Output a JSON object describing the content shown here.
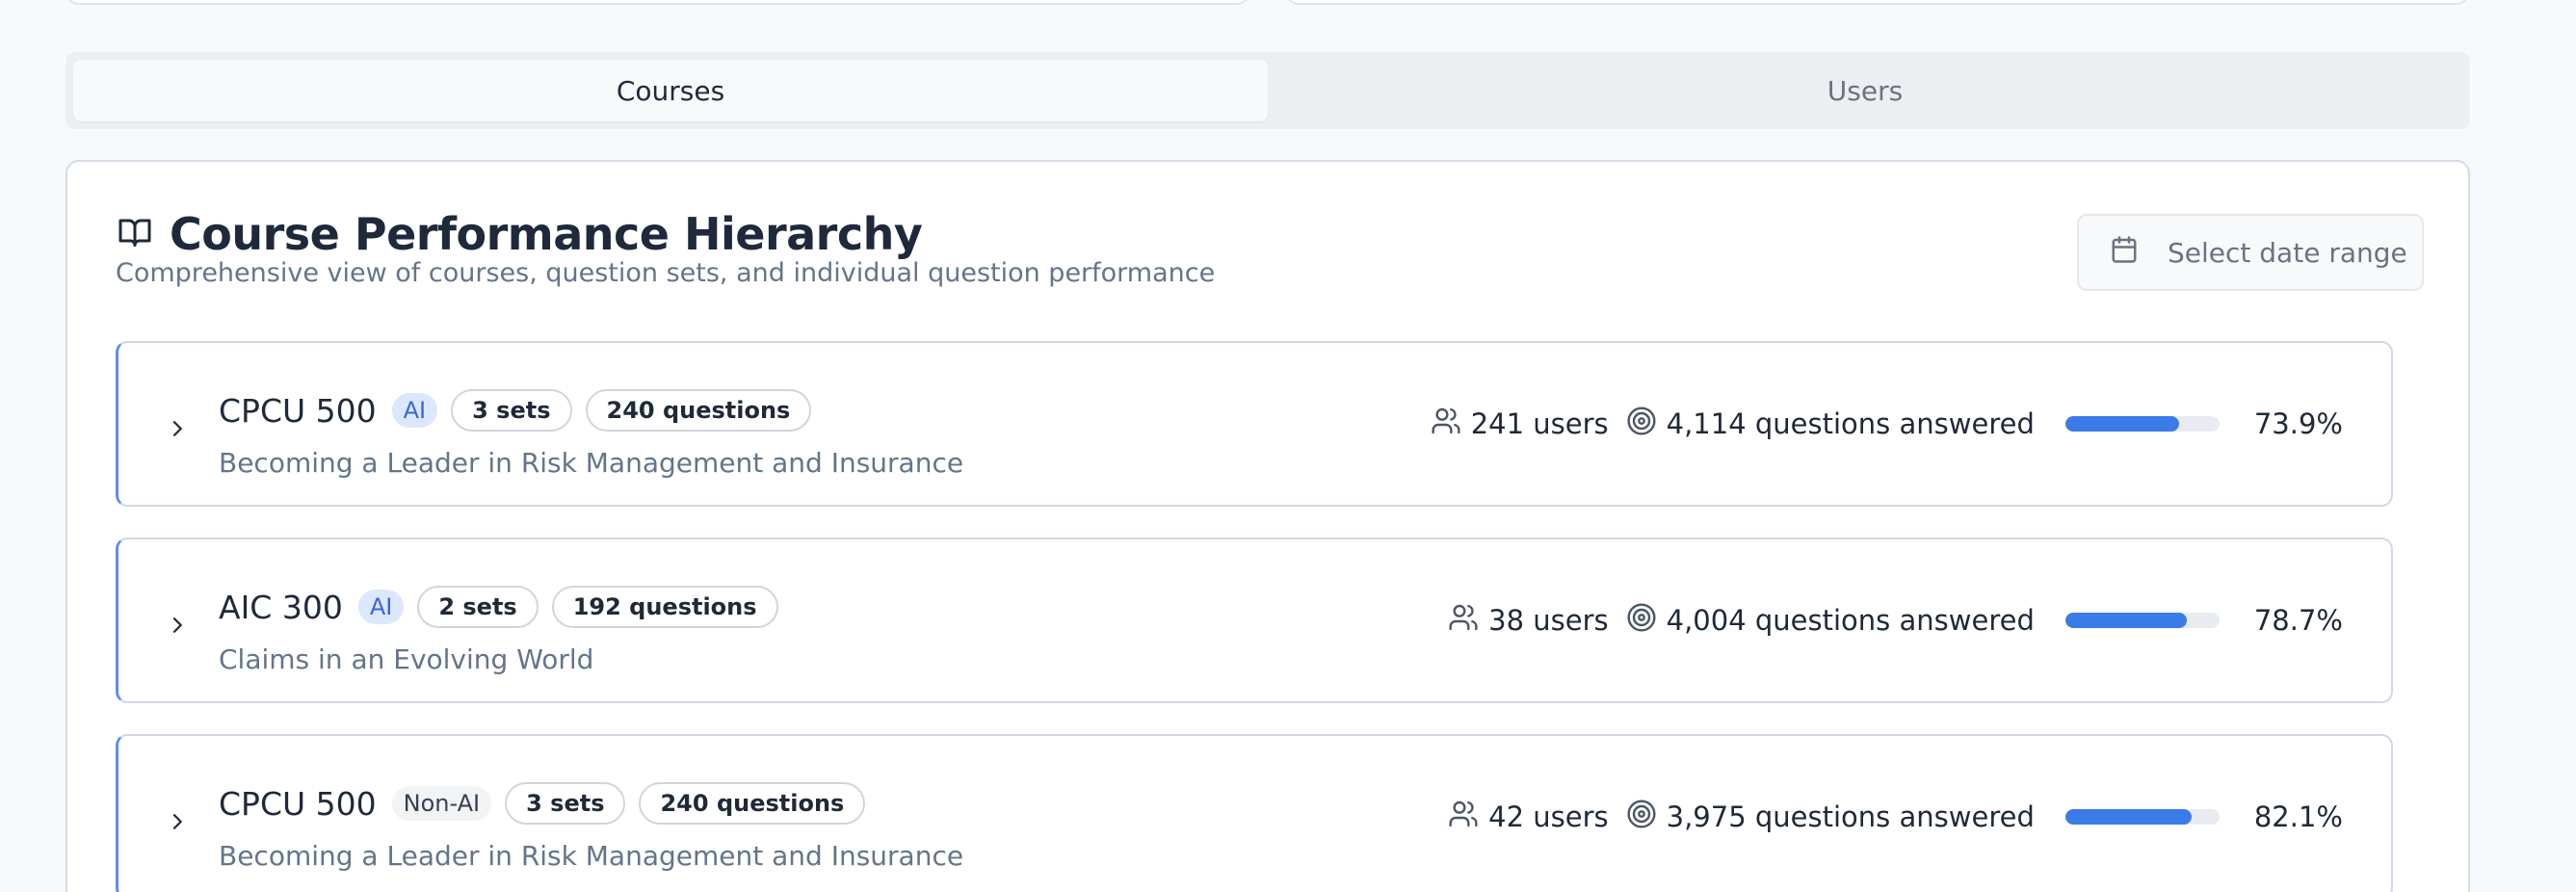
{
  "tabs": [
    {
      "label": "Courses",
      "active": true
    },
    {
      "label": "Users",
      "active": false
    }
  ],
  "panel": {
    "title": "Course Performance Hierarchy",
    "subtitle": "Comprehensive view of courses, question sets, and individual question performance",
    "date_placeholder": "Select date range",
    "title_icon": "book-open-icon",
    "date_icon": "calendar-icon"
  },
  "courses": [
    {
      "name": "CPCU 500",
      "type": "AI",
      "sets": "3 sets",
      "questions": "240 questions",
      "description": "Becoming a Leader in Risk Management and Insurance",
      "users": "241 users",
      "answered": "4,114 questions answered",
      "progress": 0.739,
      "percent": "73.9%"
    },
    {
      "name": "AIC 300",
      "type": "AI",
      "sets": "2 sets",
      "questions": "192 questions",
      "description": "Claims in an Evolving World",
      "users": "38 users",
      "answered": "4,004 questions answered",
      "progress": 0.787,
      "percent": "78.7%"
    },
    {
      "name": "CPCU 500",
      "type": "Non-AI",
      "sets": "3 sets",
      "questions": "240 questions",
      "description": "Becoming a Leader in Risk Management and Insurance",
      "users": "42 users",
      "answered": "3,975 questions answered",
      "progress": 0.821,
      "percent": "82.1%"
    }
  ],
  "colors": {
    "accent": "#3b7be8",
    "ai_badge_bg": "#dbe7fd",
    "ai_badge_text": "#3b66d6"
  }
}
